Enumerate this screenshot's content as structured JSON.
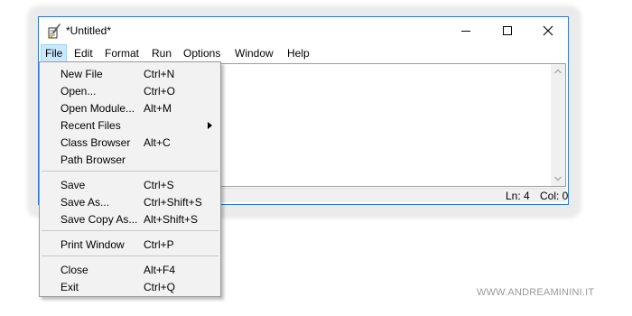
{
  "window": {
    "title": "*Untitled*",
    "icon": "idle-feather-icon",
    "controls": [
      "minimize-icon",
      "maximize-icon",
      "close-icon"
    ]
  },
  "menubar": {
    "items": [
      "File",
      "Edit",
      "Format",
      "Run",
      "Options",
      "Window",
      "Help"
    ],
    "active": "File"
  },
  "file_menu": {
    "groups": [
      [
        {
          "label": "New File",
          "shortcut": "Ctrl+N"
        },
        {
          "label": "Open...",
          "shortcut": "Ctrl+O"
        },
        {
          "label": "Open Module...",
          "shortcut": "Alt+M"
        },
        {
          "label": "Recent Files",
          "shortcut": "",
          "submenu": true
        },
        {
          "label": "Class Browser",
          "shortcut": "Alt+C"
        },
        {
          "label": "Path Browser",
          "shortcut": ""
        }
      ],
      [
        {
          "label": "Save",
          "shortcut": "Ctrl+S"
        },
        {
          "label": "Save As...",
          "shortcut": "Ctrl+Shift+S"
        },
        {
          "label": "Save Copy As...",
          "shortcut": "Alt+Shift+S"
        }
      ],
      [
        {
          "label": "Print Window",
          "shortcut": "Ctrl+P"
        }
      ],
      [
        {
          "label": "Close",
          "shortcut": "Alt+F4"
        },
        {
          "label": "Exit",
          "shortcut": "Ctrl+Q"
        }
      ]
    ]
  },
  "status": {
    "ln": "Ln: 4",
    "col": "Col: 0"
  },
  "watermark": "WWW.ANDREAMININI.IT",
  "colors": {
    "active_menu_bg": "#cce8ff",
    "window_border": "#2b79d6",
    "menu_bg": "#f2f2f2"
  }
}
